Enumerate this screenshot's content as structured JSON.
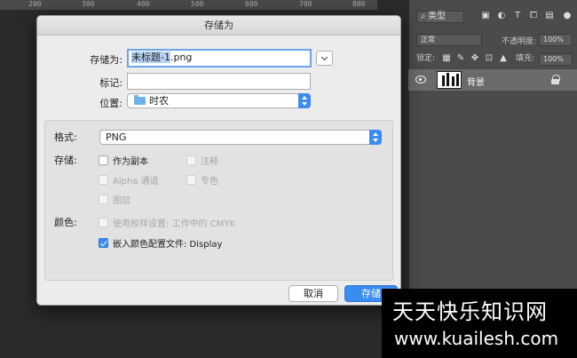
{
  "ruler": {
    "ticks": [
      "200",
      "300",
      "400",
      "500",
      "600",
      "700",
      "800"
    ]
  },
  "layers_panel": {
    "kind_label": "类型",
    "blend_mode": "正常",
    "opacity_label": "不透明度:",
    "opacity_value": "100%",
    "lock_label": "锁定:",
    "fill_label": "填充:",
    "fill_value": "100%",
    "layer_name": "背景"
  },
  "dialog": {
    "title": "存储为",
    "save_as_label": "存储为:",
    "filename_selected": "未标题-1",
    "filename_ext": ".png",
    "tags_label": "标记:",
    "tags_value": "",
    "location_label": "位置:",
    "location_value": "时农",
    "format_label": "格式:",
    "format_value": "PNG",
    "save_section_label": "存储:",
    "options": {
      "as_copy": "作为副本",
      "notes": "注释",
      "alpha": "Alpha 通道",
      "spot": "专色",
      "layers": "图层"
    },
    "color_label": "颜色:",
    "use_proof": "使用校样设置: 工作中的 CMYK",
    "embed_profile": "嵌入颜色配置文件: Display",
    "cancel_label": "取消",
    "save_label": "存储"
  },
  "watermark": {
    "line1": "天天快乐知识网",
    "line2": "www.kuailesh.com"
  }
}
